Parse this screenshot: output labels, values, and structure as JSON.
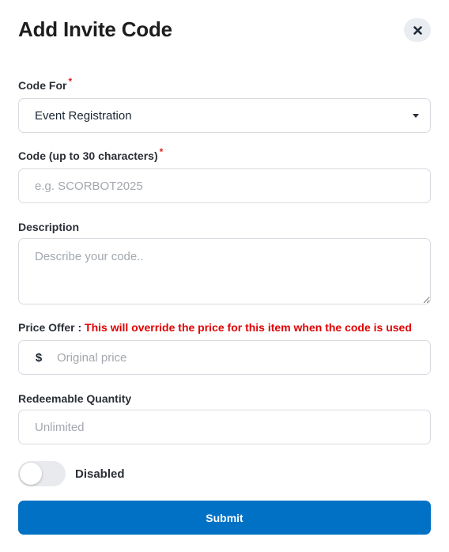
{
  "dialog": {
    "title": "Add Invite Code"
  },
  "code_for": {
    "label": "Code For",
    "required_mark": "*",
    "selected": "Event Registration"
  },
  "code": {
    "label": "Code (up to 30 characters)",
    "required_mark": "*",
    "value": "",
    "placeholder": "e.g. SCORBOT2025"
  },
  "description": {
    "label": "Description",
    "value": "",
    "placeholder": "Describe your code.."
  },
  "price_offer": {
    "label": "Price Offer : ",
    "warning": "This will override the price for this item when the code is used",
    "currency_symbol": "$",
    "value": "",
    "placeholder": "Original price"
  },
  "redeemable_quantity": {
    "label": "Redeemable Quantity",
    "value": "",
    "placeholder": "Unlimited"
  },
  "status_toggle": {
    "state": "off",
    "label": "Disabled"
  },
  "submit": {
    "label": "Submit"
  },
  "colors": {
    "primary": "#0071c5",
    "required": "#e11d1d",
    "warning": "#e00000"
  },
  "icons": {
    "close": "close-icon",
    "dropdown": "chevron-down-icon"
  }
}
